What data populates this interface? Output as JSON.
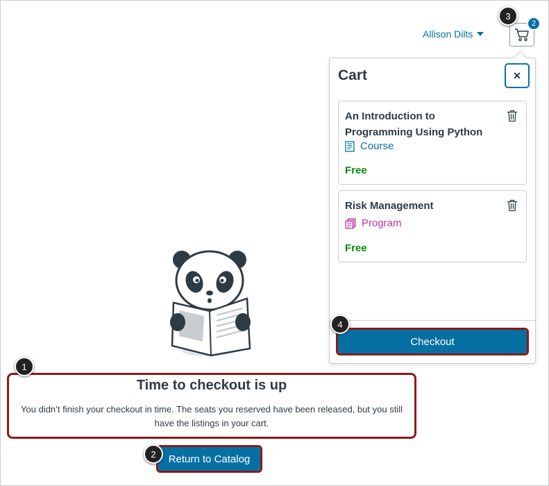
{
  "header": {
    "user_name": "Allison Dilts",
    "cart_count": "2"
  },
  "cart": {
    "title": "Cart",
    "close_label": "×",
    "items": [
      {
        "title": "An Introduction to Programming Using Python",
        "type": "Course",
        "price": "Free"
      },
      {
        "title": "Risk Management",
        "type": "Program",
        "price": "Free"
      }
    ],
    "checkout_label": "Checkout"
  },
  "message": {
    "title": "Time to checkout is up",
    "body": "You didn’t finish your checkout in time. The seats you reserved have been released, but you still have the listings in your cart."
  },
  "return_label": "Return to Catalog",
  "markers": [
    "1",
    "2",
    "3",
    "4"
  ],
  "colors": {
    "accent": "#0770a3",
    "highlight": "#8b1a1a",
    "price": "#0b8a0b",
    "program": "#bf32a4"
  }
}
